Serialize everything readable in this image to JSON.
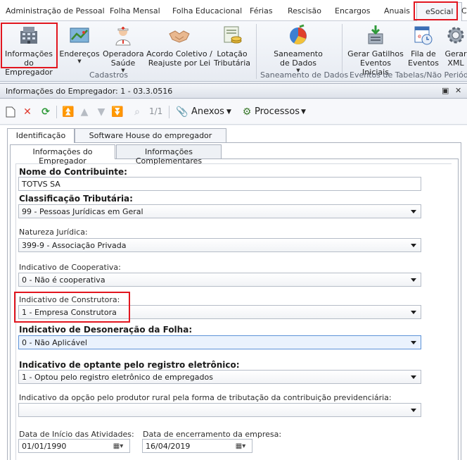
{
  "ribbon_tabs": [
    {
      "label": "Administração de Pessoal"
    },
    {
      "label": "Folha Mensal"
    },
    {
      "label": "Folha Educacional"
    },
    {
      "label": "Férias"
    },
    {
      "label": "Rescisão"
    },
    {
      "label": "Encargos"
    },
    {
      "label": "Anuais"
    },
    {
      "label": "eSocial",
      "active": true
    },
    {
      "label": "C"
    }
  ],
  "ribbon": {
    "buttons": [
      {
        "label1": "Informações",
        "label2": "do Empregador",
        "icon": "building-icon"
      },
      {
        "label1": "Endereços",
        "label2": "",
        "icon": "map-icon",
        "dropdown": true
      },
      {
        "label1": "Operadora",
        "label2": "Saúde",
        "icon": "nurse-icon",
        "dropdown": true
      },
      {
        "label1": "Acordo Coletivo /",
        "label2": "Reajuste por Lei",
        "icon": "handshake-icon"
      },
      {
        "label1": "Lotação",
        "label2": "Tributária",
        "icon": "money-icon"
      },
      {
        "label1": "Saneamento",
        "label2": "de Dados",
        "icon": "pie-chart-icon",
        "dropdown": true
      },
      {
        "label1": "Gerar Gatilhos",
        "label2": "Eventos Iniciais",
        "icon": "download-server-icon"
      },
      {
        "label1": "Fila de",
        "label2": "Eventos",
        "icon": "queue-icon"
      },
      {
        "label1": "Gerar",
        "label2": "XML",
        "icon": "gear-icon"
      }
    ],
    "groups": {
      "cadastros": "Cadastros",
      "saneamento": "Saneamento de Dados",
      "eventos": "Eventos de Tabelas/Não Periódicos"
    }
  },
  "window": {
    "title": "Informações do Empregador: 1 - 03.3.0516",
    "pin_glyph": "▣",
    "close_glyph": "✕"
  },
  "toolbar": {
    "record_counter": "1/1",
    "anexos_label": "Anexos",
    "processos_label": "Processos"
  },
  "tabs_level1": [
    {
      "label": "Identificação",
      "active": true
    },
    {
      "label": "Software House do empregador"
    }
  ],
  "tabs_level2": [
    {
      "label": "Informações do Empregador",
      "active": true
    },
    {
      "label": "Informações Complementares"
    }
  ],
  "form": {
    "nome_contribuinte": {
      "label": "Nome do Contribuinte:",
      "value": "TOTVS SA"
    },
    "classificacao_tributaria": {
      "label": "Classificação Tributária:",
      "value": "99 - Pessoas Jurídicas em Geral"
    },
    "natureza_juridica": {
      "label": "Natureza Jurídica:",
      "value": "399-9 - Associação Privada"
    },
    "indicativo_cooperativa": {
      "label": "Indicativo de Cooperativa:",
      "value": "0 - Não é cooperativa"
    },
    "indicativo_construtora": {
      "label": "Indicativo de Construtora:",
      "value": "1 - Empresa Construtora"
    },
    "indicativo_desoneracao": {
      "label": "Indicativo de Desoneração da Folha:",
      "value": "0 - Não Aplicável"
    },
    "indicativo_registro_eletronico": {
      "label": "Indicativo de optante pelo registro eletrônico:",
      "value": "1 - Optou pelo registro eletrônico de empregados"
    },
    "indicativo_produtor_rural": {
      "label": "Indicativo da opção pelo produtor rural pela forma de tributação da contribuição previdenciária:",
      "value": ""
    },
    "data_inicio": {
      "label": "Data de Início das Atividades:",
      "value": "01/01/1990"
    },
    "data_encerramento": {
      "label": "Data de encerramento da empresa:",
      "value": "16/04/2019"
    }
  },
  "colors": {
    "highlight": "#e2161f",
    "focus": "#5d93d8"
  }
}
